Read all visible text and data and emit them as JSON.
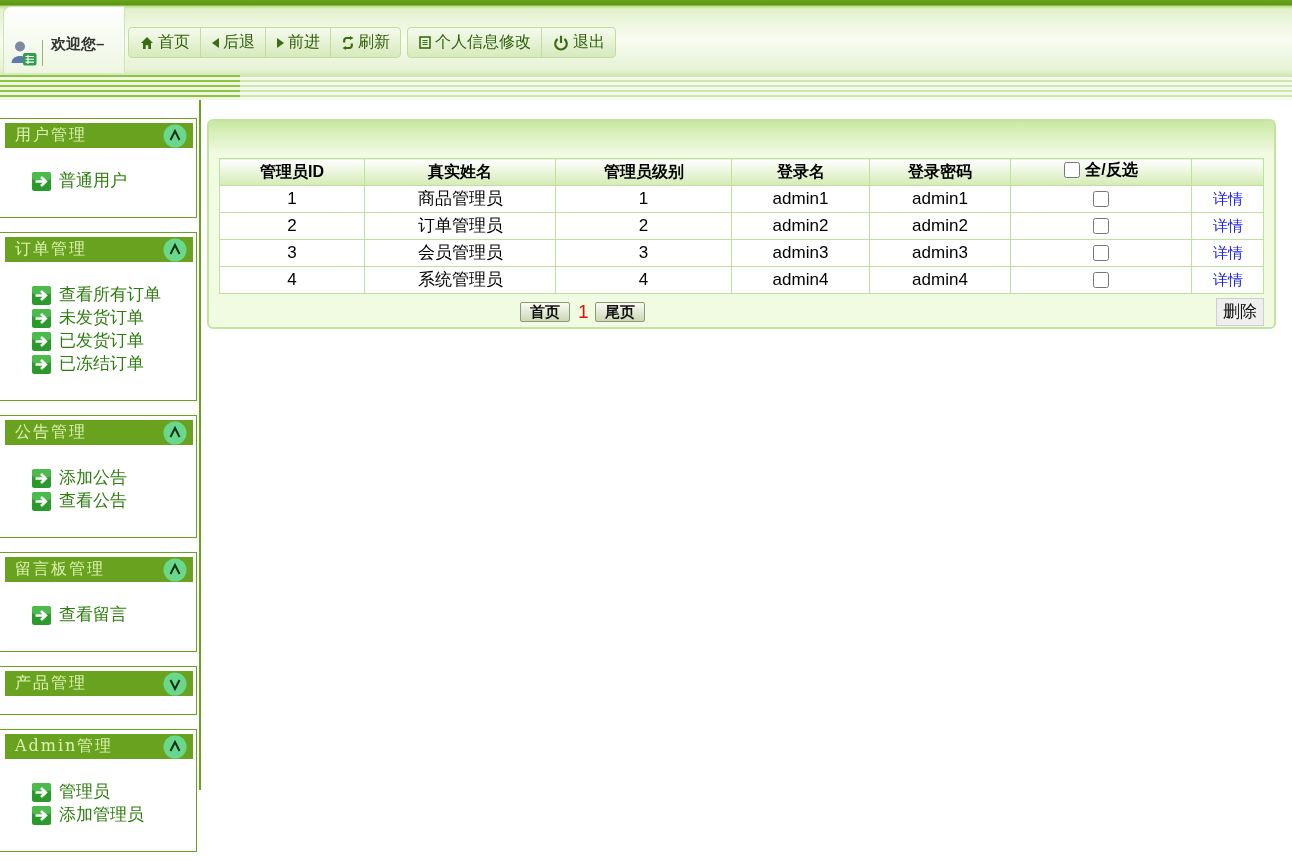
{
  "header": {
    "welcome": "欢迎您–",
    "toolbar_groups": [
      {
        "buttons": [
          "首页",
          "后退",
          "前进",
          "刷新"
        ]
      },
      {
        "buttons": [
          "个人信息修改",
          "退出"
        ]
      }
    ]
  },
  "sidebar": {
    "sections": [
      {
        "title": "用户管理",
        "expanded": true,
        "items": [
          "普通用户"
        ]
      },
      {
        "title": "订单管理",
        "expanded": true,
        "items": [
          "查看所有订单",
          "未发货订单",
          "已发货订单",
          "已冻结订单"
        ]
      },
      {
        "title": "公告管理",
        "expanded": true,
        "items": [
          "添加公告",
          "查看公告"
        ]
      },
      {
        "title": "留言板管理",
        "expanded": true,
        "items": [
          "查看留言"
        ]
      },
      {
        "title": "产品管理",
        "expanded": false
      },
      {
        "title": "Admin管理",
        "expanded": true,
        "items": [
          "管理员",
          "添加管理员"
        ]
      }
    ]
  },
  "table": {
    "columns": [
      "管理员ID",
      "真实姓名",
      "管理员级别",
      "登录名",
      "登录密码"
    ],
    "select_all": {
      "label": "全/反选",
      "checked": false
    },
    "rows": [
      {
        "cells": [
          "1",
          "商品管理员",
          "1",
          "admin1",
          "admin1"
        ],
        "checked": false,
        "link": "详情"
      },
      {
        "cells": [
          "2",
          "订单管理员",
          "2",
          "admin2",
          "admin2"
        ],
        "checked": false,
        "link": "详情"
      },
      {
        "cells": [
          "3",
          "会员管理员",
          "3",
          "admin3",
          "admin3"
        ],
        "checked": false,
        "link": "详情"
      },
      {
        "cells": [
          "4",
          "系统管理员",
          "4",
          "admin4",
          "admin4"
        ],
        "checked": false,
        "link": "详情"
      }
    ]
  },
  "pagination": {
    "first_button": "首页",
    "current_page": "1",
    "last_button": "尾页"
  },
  "delete_button": "删除"
}
